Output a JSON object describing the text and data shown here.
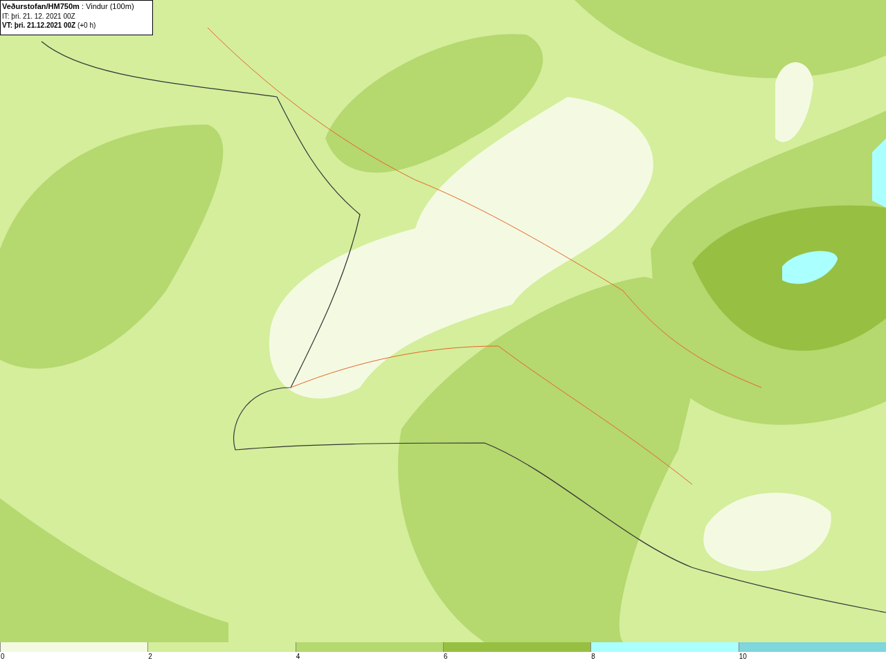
{
  "title_box": {
    "lines": [
      "**Veðurstofan/HM750m** : Vindur (100m)",
      "IT: þri. 21. 12. 2021 00Z",
      "**VT: þri. 21.12.2021 00Z** (+0 h)"
    ]
  },
  "legend": {
    "bins": [
      {
        "color": "#f4fae2",
        "label": "0"
      },
      {
        "color": "#d4ee9c",
        "label": "2"
      },
      {
        "color": "#b5d86f",
        "label": "4"
      },
      {
        "color": "#97c043",
        "label": "6"
      },
      {
        "color": "#aaffff",
        "label": "8"
      },
      {
        "color": "#7fd6dc",
        "label": "10"
      }
    ]
  }
}
